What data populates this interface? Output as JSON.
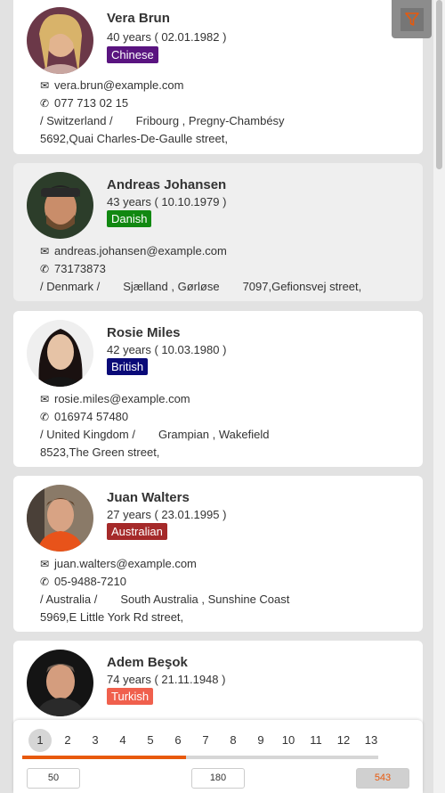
{
  "people": [
    {
      "name": "Vera Brun",
      "age": "40 years ( 02.01.1982 )",
      "nationality": "Chinese",
      "nat_color": "#5a1480",
      "email": "vera.brun@example.com",
      "phone": "077 713 02 15",
      "country": "/ Switzerland /",
      "region": "Fribourg , Pregny-Chambésy",
      "street": "5692,Quai Charles-De-Gaulle street,",
      "email_icon": "envelope-icon",
      "phone_icon": "phone-icon"
    },
    {
      "name": "Andreas Johansen",
      "age": "43 years ( 10.10.1979 )",
      "nationality": "Danish",
      "nat_color": "#118811",
      "email": "andreas.johansen@example.com",
      "phone": "73173873",
      "country": "/ Denmark /",
      "region": "Sjælland , Gørløse",
      "street": "7097,Gefionsvej street,",
      "email_icon": "envelope-icon",
      "phone_icon": "phone-icon"
    },
    {
      "name": "Rosie Miles",
      "age": "42 years ( 10.03.1980 )",
      "nationality": "British",
      "nat_color": "#0a0a78",
      "email": "rosie.miles@example.com",
      "phone": "016974 57480",
      "country": "/ United Kingdom /",
      "region": "Grampian , Wakefield",
      "street": "8523,The Green street,",
      "email_icon": "envelope-icon",
      "phone_icon": "phone-icon"
    },
    {
      "name": "Juan Walters",
      "age": "27 years ( 23.01.1995 )",
      "nationality": "Australian",
      "nat_color": "#a52a2a",
      "email": "juan.walters@example.com",
      "phone": "05-9488-7210",
      "country": "/ Australia /",
      "region": "South Australia , Sunshine Coast",
      "street": "5969,E Little York Rd street,",
      "email_icon": "envelope-icon",
      "phone_icon": "phone-icon"
    },
    {
      "name": "Adem Beşok",
      "age": "74 years ( 21.11.1948 )",
      "nationality": "Turkish",
      "nat_color": "#f0604d",
      "email": "",
      "phone": "",
      "country": "",
      "region": "",
      "street": ""
    }
  ],
  "filter": {
    "icon": "filter-icon",
    "color": "#e8590c"
  },
  "pagination": {
    "pages": [
      "1",
      "2",
      "3",
      "4",
      "5",
      "6",
      "7",
      "8",
      "9",
      "10",
      "11",
      "12",
      "13"
    ],
    "active_page": "1",
    "progress_fraction": 0.46,
    "progress_color": "#e8590c",
    "range_boxes": [
      "50",
      "180",
      "543"
    ]
  }
}
